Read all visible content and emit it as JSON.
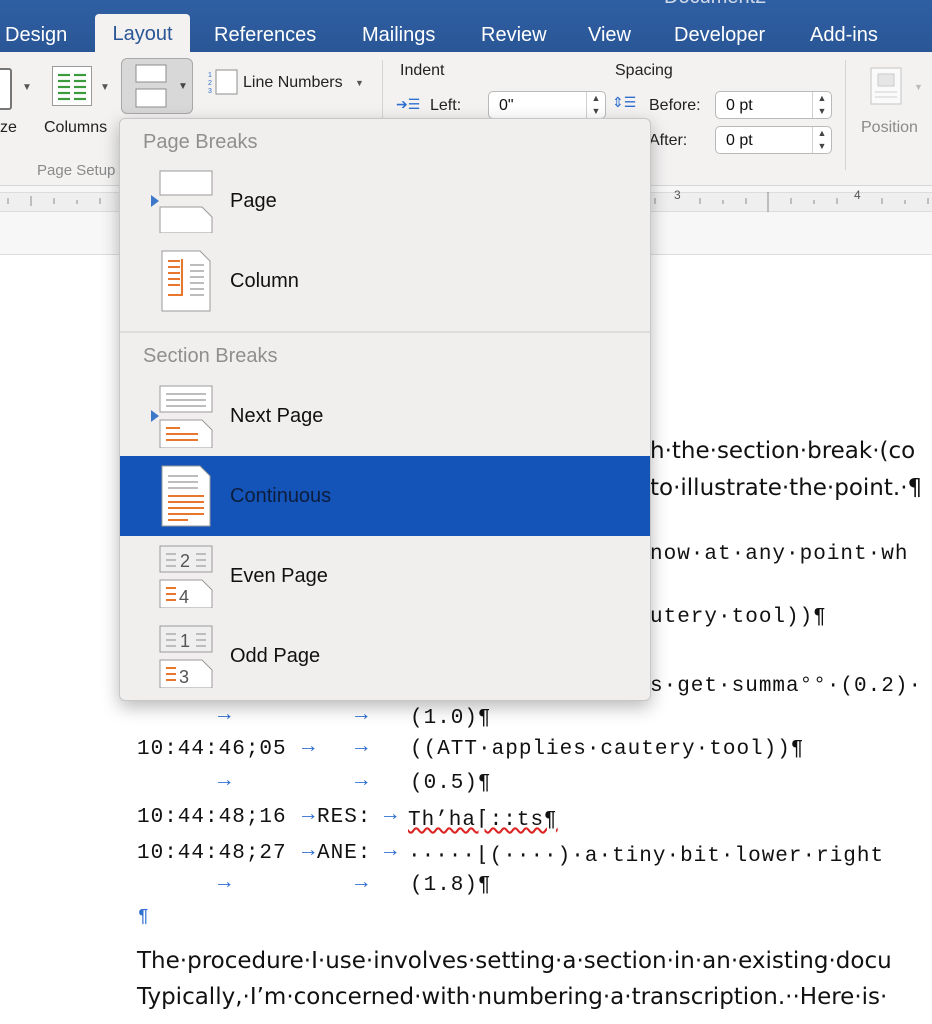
{
  "tabs": [
    {
      "label": "Design",
      "active": false
    },
    {
      "label": "Layout",
      "active": true
    },
    {
      "label": "References",
      "active": false
    },
    {
      "label": "Mailings",
      "active": false
    },
    {
      "label": "Review",
      "active": false
    },
    {
      "label": "View",
      "active": false
    },
    {
      "label": "Developer",
      "active": false
    },
    {
      "label": "Add-ins",
      "active": false
    }
  ],
  "title_fragment": "Document2",
  "ribbon": {
    "size_label_fragment": "ze",
    "columns_label": "Columns",
    "page_setup_label_fragment": "Page Setup",
    "line_numbers_label": "Line Numbers",
    "indent_label": "Indent",
    "left_label": "Left:",
    "left_value": "0\"",
    "spacing_label": "Spacing",
    "before_label": "Before:",
    "before_value": "0 pt",
    "after_label": "After:",
    "after_value": "0 pt",
    "position_label": "Position"
  },
  "ruler": {
    "marks": [
      "3",
      "4"
    ]
  },
  "menu": {
    "page_breaks_heading": "Page Breaks",
    "section_breaks_heading": "Section Breaks",
    "items": [
      {
        "label": "Page",
        "icon": "page-break-icon"
      },
      {
        "label": "Column",
        "icon": "column-break-icon"
      },
      {
        "label": "Next Page",
        "icon": "next-page-break-icon"
      },
      {
        "label": "Continuous",
        "icon": "continuous-break-icon",
        "selected": true
      },
      {
        "label": "Even Page",
        "icon": "even-page-break-icon",
        "page_numbers": [
          "2",
          "4"
        ]
      },
      {
        "label": "Odd Page",
        "icon": "odd-page-break-icon",
        "page_numbers": [
          "1",
          "3"
        ]
      }
    ]
  },
  "document": {
    "visible_fragments": [
      "h·the·section·break·(co",
      "to·illustrate·the·point.·¶",
      "now·at·any·point·wh",
      "utery·tool))¶",
      "s·get·summa°°·(0.2)·"
    ],
    "transcript": [
      {
        "time": "",
        "speaker": "",
        "text": "(1.0)¶"
      },
      {
        "time": "10:44:46;05",
        "speaker": "",
        "text": "((ATT·applies·cautery·tool))¶"
      },
      {
        "time": "",
        "speaker": "",
        "text": "(0.5)¶"
      },
      {
        "time": "10:44:48;16",
        "speaker": "RES:",
        "text": "Th’ha⌈::ts¶"
      },
      {
        "time": "10:44:48;27",
        "speaker": "ANE:",
        "text": "·····⌊(····)·a·tiny·bit·lower·right"
      },
      {
        "time": "",
        "speaker": "",
        "text": "(1.8)¶"
      }
    ],
    "empty_pilcrow": "¶",
    "paragraph_lines": [
      "The·procedure·I·use·involves·setting·a·section·in·an·existing·docu",
      "Typically,·I’m·concerned·with·numbering·a·transcription.··Here·is·"
    ]
  },
  "colors": {
    "ribbon_blue": "#2a5696",
    "selection_blue": "#1453b8",
    "accent_orange": "#e8762d"
  }
}
